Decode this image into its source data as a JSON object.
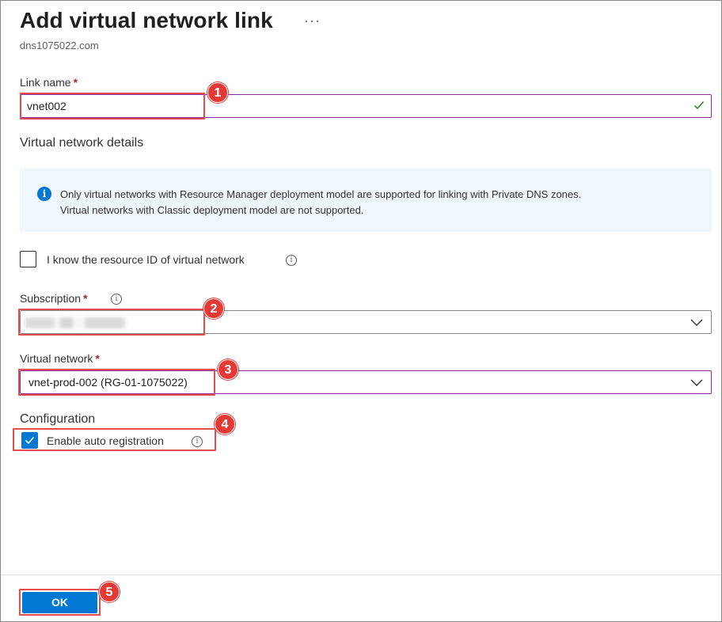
{
  "panel": {
    "title": "Add virtual network link",
    "more_label": "···",
    "subtitle": "dns1075022.com"
  },
  "link_name": {
    "label": "Link name",
    "required_mark": "*",
    "value": "vnet002",
    "valid_icon": "checkmark-icon"
  },
  "details": {
    "heading": "Virtual network details",
    "info_icon": "info-icon",
    "info_text_line1": "Only virtual networks with Resource Manager deployment model are supported for linking with Private DNS zones.",
    "info_text_line2": "Virtual networks with Classic deployment model are not supported."
  },
  "resource_id": {
    "label": "I know the resource ID of virtual network",
    "checked": false,
    "tooltip_icon": "info-circle-icon"
  },
  "subscription": {
    "label": "Subscription",
    "required_mark": "*",
    "value_redacted": true,
    "tooltip_icon": "info-circle-icon"
  },
  "virtual_network": {
    "label": "Virtual network",
    "required_mark": "*",
    "value": "vnet-prod-002 (RG-01-1075022)"
  },
  "configuration": {
    "heading": "Configuration",
    "auto_registration_label": "Enable auto registration",
    "auto_registration_checked": true,
    "tooltip_icon": "info-circle-icon"
  },
  "footer": {
    "ok_label": "OK"
  },
  "callouts": [
    "1",
    "2",
    "3",
    "4",
    "5"
  ],
  "colors": {
    "accent": "#0078d4",
    "focus_border": "#8a2da5",
    "required": "#a4262c",
    "valid": "#107c10",
    "info_bg": "#eff6fc",
    "callout": "#e53935"
  }
}
